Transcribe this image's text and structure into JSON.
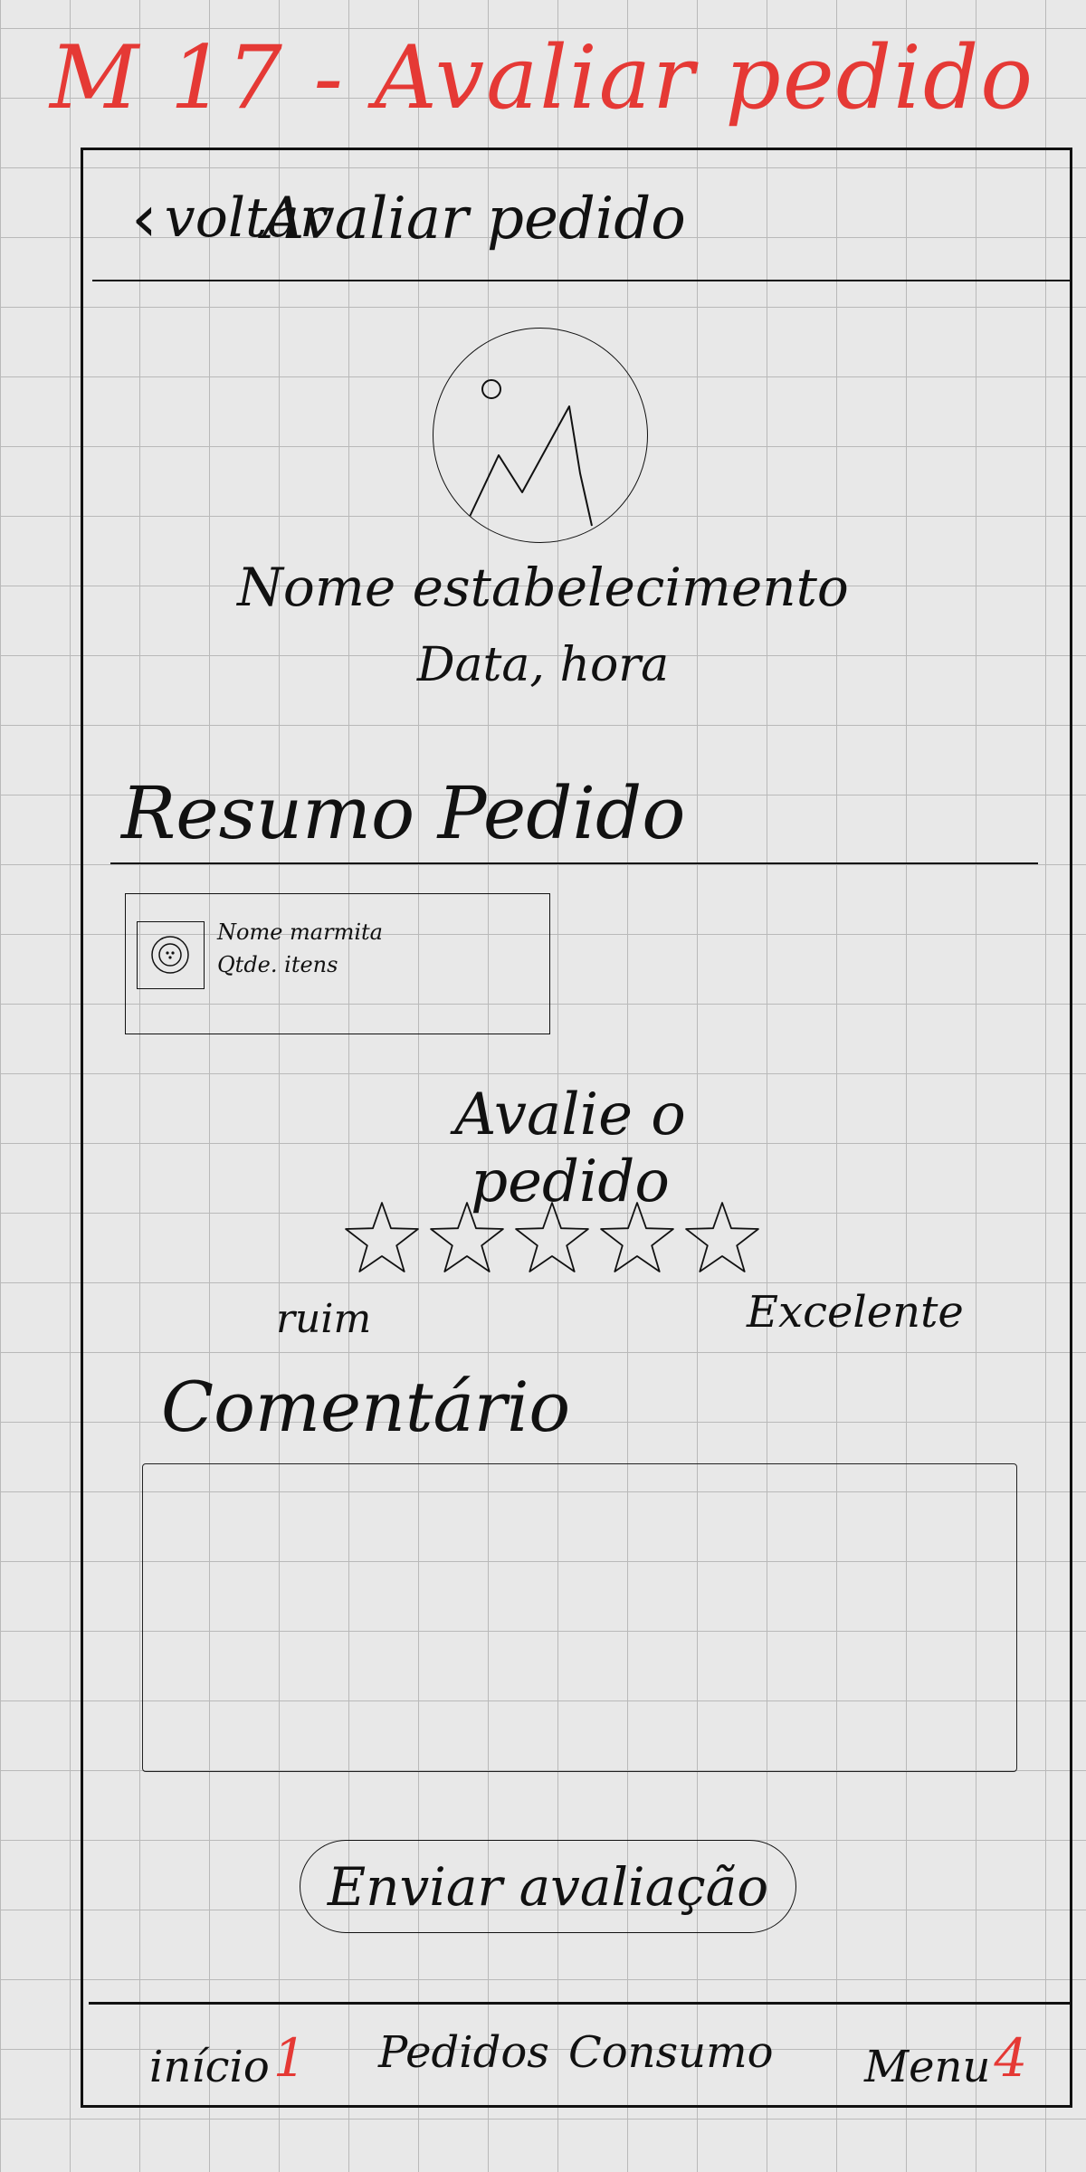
{
  "sheet": {
    "title": "M 17 - Avaliar pedido"
  },
  "header": {
    "back_label": "voltar",
    "title": "Avaliar pedido"
  },
  "store": {
    "name": "Nome estabelecimento",
    "date_time": "Data, hora"
  },
  "summary": {
    "title": "Resumo Pedido",
    "item": {
      "product_name": "Nome marmita",
      "quantity": "Qtde. itens"
    }
  },
  "rating": {
    "title": "Avalie o pedido",
    "stars_total": 5,
    "stars_filled": 0,
    "min_label": "ruim",
    "max_label": "Excelente"
  },
  "comment": {
    "title": "Comentário",
    "value": "",
    "placeholder": ""
  },
  "submit": {
    "label": "Enviar avaliação"
  },
  "nav": {
    "items": [
      {
        "label": "início",
        "number": "1"
      },
      {
        "label": "Pedidos",
        "number": ""
      },
      {
        "label": "Consumo",
        "number": ""
      },
      {
        "label": "Menu",
        "number": "4"
      }
    ]
  }
}
